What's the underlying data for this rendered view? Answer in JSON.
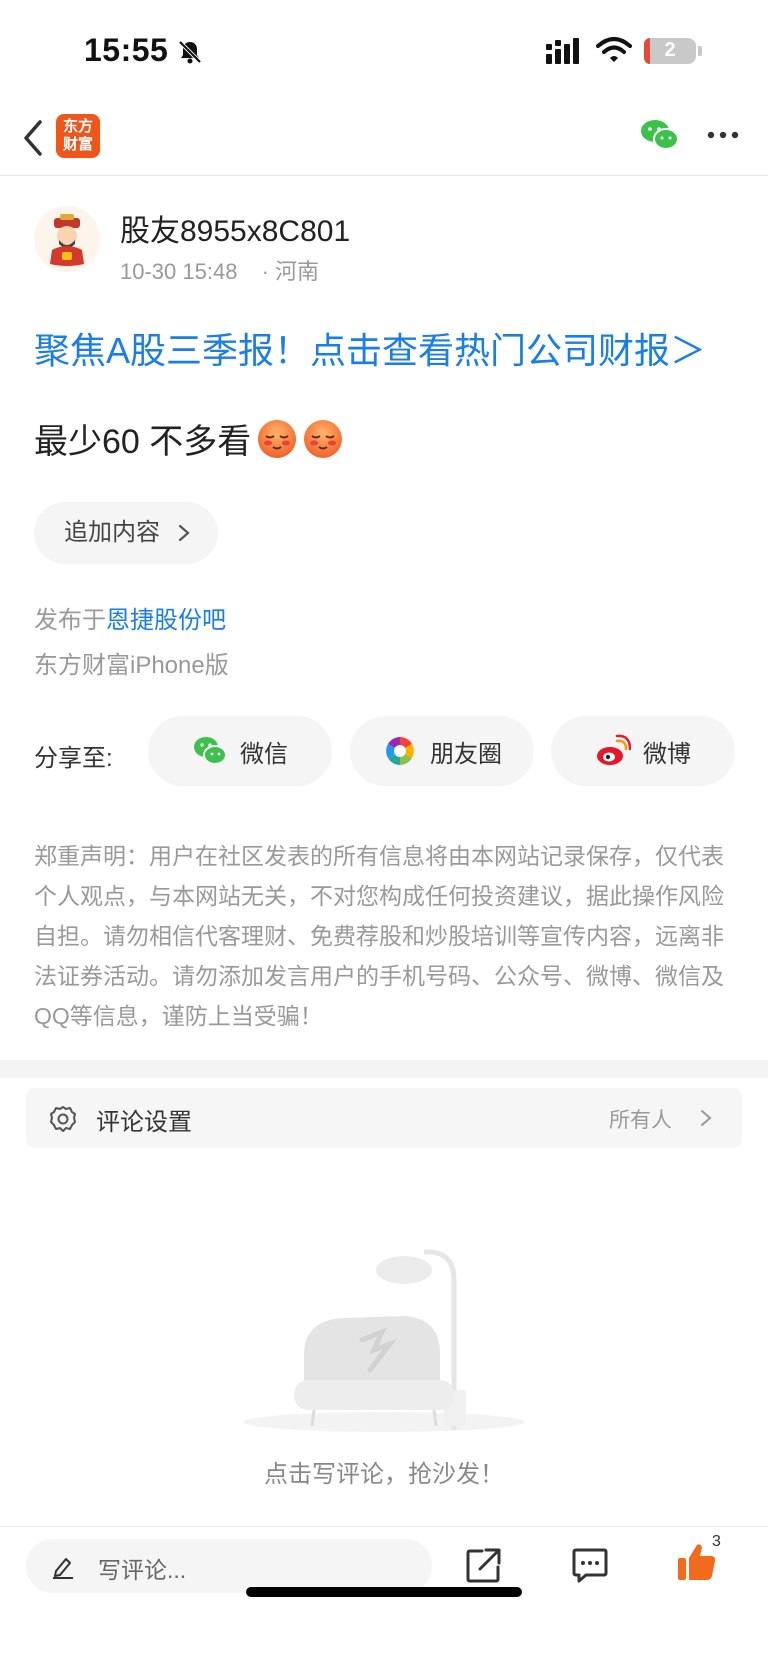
{
  "status_bar": {
    "time": "15:55",
    "battery": "2"
  },
  "nav": {
    "logo_text": "东方\n财富"
  },
  "author": {
    "name": "股友8955x8C801",
    "time": "10-30 15:48",
    "location": "· 河南"
  },
  "promo_link": "聚焦A股三季报！点击查看热门公司财报＞",
  "post": {
    "text": "最少60 不多看"
  },
  "add_content_label": "追加内容",
  "posted_in": {
    "prefix": "发布于",
    "bar_name": "恩捷股份吧"
  },
  "device": "东方财富iPhone版",
  "share": {
    "label": "分享至:",
    "wechat": "微信",
    "moments": "朋友圈",
    "weibo": "微博"
  },
  "disclaimer": "郑重声明：用户在社区发表的所有信息将由本网站记录保存，仅代表个人观点，与本网站无关，不对您构成任何投资建议，据此操作风险自担。请勿相信代客理财、免费荐股和炒股培训等宣传内容，远离非法证券活动。请勿添加发言用户的手机号码、公众号、微博、微信及QQ等信息，谨防上当受骗！",
  "comment_settings": {
    "label": "评论设置",
    "value": "所有人"
  },
  "empty_state": "点击写评论，抢沙发！",
  "bottom_bar": {
    "placeholder": "写评论...",
    "like_count": "3"
  },
  "colors": {
    "brand": "#f0561a",
    "link": "#1a7ee6",
    "like": "#f26a1b"
  }
}
